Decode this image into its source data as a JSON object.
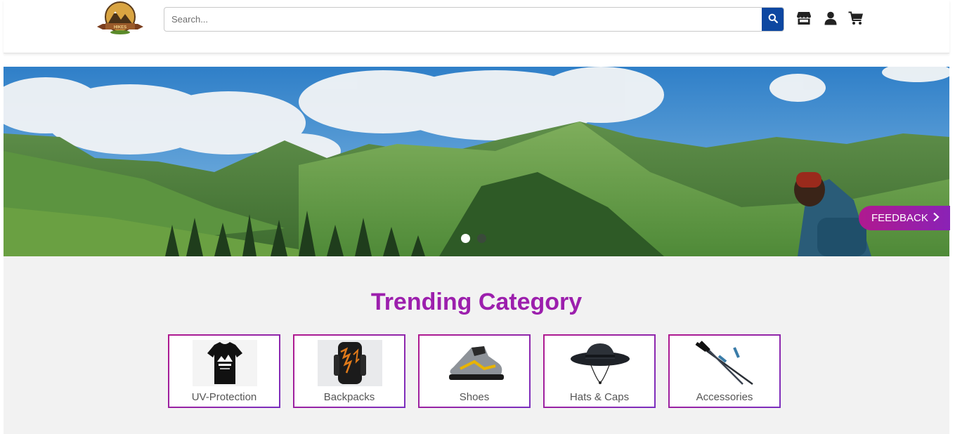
{
  "header": {
    "logo_text": "HIKES",
    "search": {
      "placeholder": "Search...",
      "value": ""
    },
    "icons": [
      "search-icon",
      "store-icon",
      "user-icon",
      "cart-icon"
    ]
  },
  "hero": {
    "slides_total": 2,
    "active_slide": 1,
    "feedback_label": "FEEDBACK"
  },
  "trending": {
    "title": "Trending Category",
    "categories": [
      {
        "label": "UV-Protection",
        "icon": "tshirt-image"
      },
      {
        "label": "Backpacks",
        "icon": "backpack-image"
      },
      {
        "label": "Shoes",
        "icon": "shoe-image"
      },
      {
        "label": "Hats & Caps",
        "icon": "hat-image"
      },
      {
        "label": "Accessories",
        "icon": "trekking-poles-image"
      }
    ]
  },
  "colors": {
    "accent": "#9c1fad",
    "search_button": "#0d47a1",
    "section_bg": "#f2f2f2"
  }
}
